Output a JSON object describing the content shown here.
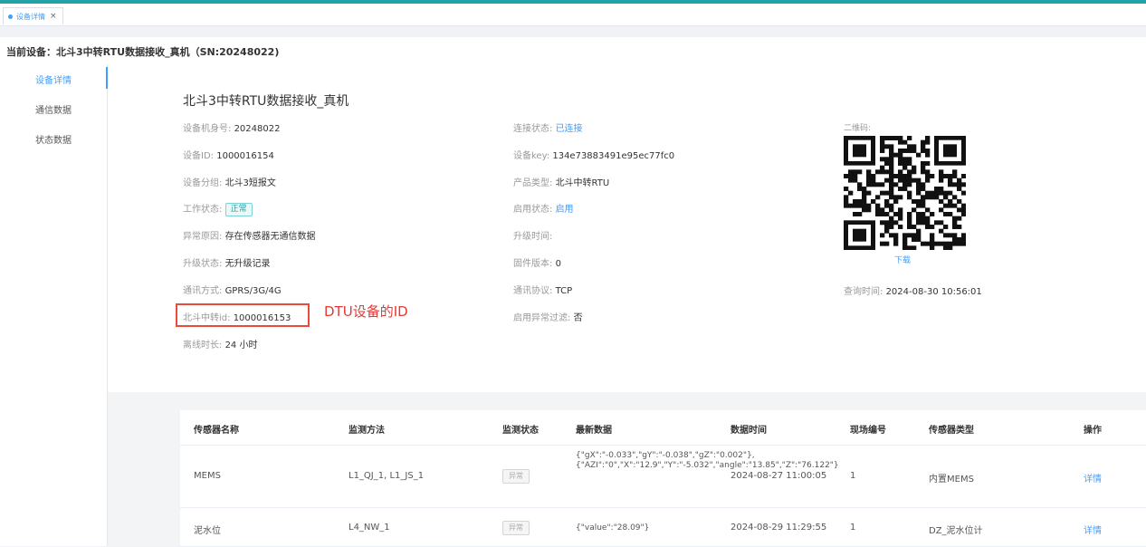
{
  "tab": {
    "label": "设备详情",
    "close": "×"
  },
  "page_title": "当前设备：北斗3中转RTU数据接收_真机（SN:20248022)",
  "sidemenu": [
    {
      "label": "设备详情",
      "active": true
    },
    {
      "label": "通信数据",
      "active": false
    },
    {
      "label": "状态数据",
      "active": false
    }
  ],
  "device": {
    "name": "北斗3中转RTU数据接收_真机",
    "left": [
      {
        "label": "设备机身号:",
        "value": "20248022"
      },
      {
        "label": "设备ID:",
        "value": "1000016154"
      },
      {
        "label": "设备分组:",
        "value": "北斗3短报文"
      },
      {
        "label": "工作状态:",
        "value": "正常"
      },
      {
        "label": "异常原因:",
        "value": "存在传感器无通信数据"
      },
      {
        "label": "升级状态:",
        "value": "无升级记录"
      },
      {
        "label": "通讯方式:",
        "value": "GPRS/3G/4G"
      },
      {
        "label": "北斗中转id:",
        "value": "1000016153"
      },
      {
        "label": "离线时长:",
        "value": "24 小时"
      }
    ],
    "right": [
      {
        "label": "连接状态:",
        "value": "已连接"
      },
      {
        "label": "设备key:",
        "value": "134e73883491e95ec77fc0"
      },
      {
        "label": "产品类型:",
        "value": "北斗中转RTU"
      },
      {
        "label": "启用状态:",
        "value": "启用"
      },
      {
        "label": "升级时间:",
        "value": ""
      },
      {
        "label": "固件版本:",
        "value": "0"
      },
      {
        "label": "通讯协议:",
        "value": "TCP"
      },
      {
        "label": "启用异常过滤:",
        "value": "否"
      }
    ],
    "qr_label": "二维码:",
    "download": "下载",
    "query_time_label": "查询时间:",
    "query_time": "2024-08-30 10:56:01",
    "annotation": "DTU设备的ID"
  },
  "table": {
    "headers": [
      "传感器名称",
      "监测方法",
      "监测状态",
      "最新数据",
      "数据时间",
      "现场编号",
      "传感器类型",
      "操作"
    ],
    "rows": [
      {
        "name": "MEMS",
        "method": "L1_QJ_1, L1_JS_1",
        "status": "异常",
        "latest": "{\"gX\":\"-0.033\",\"gY\":\"-0.038\",\"gZ\":\"0.002\"},{\"AZI\":\"0\",\"X\":\"12.9\",\"Y\":\"-5.032\",\"angle\":\"13.85\",\"Z\":\"76.122\"}",
        "time": "2024-08-27 11:00:05",
        "site": "1",
        "type": "内置MEMS",
        "op": "详情"
      },
      {
        "name": "泥水位",
        "method": "L4_NW_1",
        "status": "异常",
        "latest": "{\"value\":\"28.09\"}",
        "time": "2024-08-29 11:29:55",
        "site": "1",
        "type": "DZ_泥水位计",
        "op": "详情"
      }
    ]
  }
}
